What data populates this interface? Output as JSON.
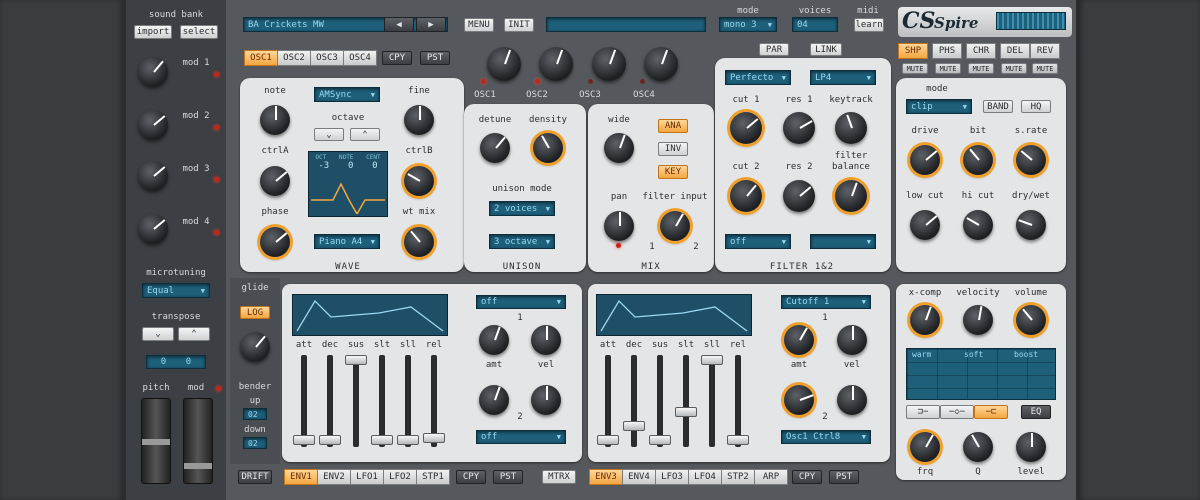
{
  "bank": {
    "title": "sound bank",
    "import": "import",
    "select": "select",
    "mods": [
      "mod 1",
      "mod 2",
      "mod 3",
      "mod 4"
    ],
    "microtuning_label": "microtuning",
    "microtuning_value": "Equal",
    "transpose_label": "transpose",
    "transpose_values": [
      "0",
      "0"
    ],
    "glide": "glide",
    "log": "LOG",
    "bender": "bender",
    "up": "up",
    "up_value": "02",
    "down": "down",
    "down_value": "02",
    "pitch": "pitch",
    "mod": "mod",
    "drift": "DRIFT"
  },
  "topbar": {
    "preset": "BA Crickets MW",
    "menu": "MENU",
    "init": "INIT",
    "mode_label": "mode",
    "mode_value": "mono 3",
    "voices_label": "voices",
    "voices_value": "04",
    "midi_label": "midi",
    "learn": "learn",
    "brand": "Spire"
  },
  "osc": {
    "tabs": [
      "OSC1",
      "OSC2",
      "OSC3",
      "OSC4"
    ],
    "cpy": "CPY",
    "pst": "PST",
    "note": "note",
    "fine": "fine",
    "type": "AMSync",
    "octave": "octave",
    "ctrlA": "ctrlA",
    "ctrlB": "ctrlB",
    "phase": "phase",
    "wtmix": "wt mix",
    "scope_labels": [
      "OCT",
      "NOTE",
      "CENT"
    ],
    "scope_values": [
      "-3",
      "0",
      "0"
    ],
    "wavetable": "Piano A4",
    "wave": "WAVE"
  },
  "mixer": {
    "osc_knobs": [
      "OSC1",
      "OSC2",
      "OSC3",
      "OSC4"
    ],
    "detune": "detune",
    "density": "density",
    "unison_mode": "unison mode",
    "voices": "2 voices",
    "octave": "3 octave",
    "unison": "UNISON",
    "wide": "wide",
    "ana": "ANA",
    "inv": "INV",
    "key": "KEY",
    "pan": "pan",
    "filter_input": "filter input",
    "fi_1": "1",
    "fi_2": "2",
    "mix": "MIX"
  },
  "filter": {
    "par": "PAR",
    "link": "LINK",
    "type1": "Perfecto",
    "type2": "LP4",
    "cut1": "cut 1",
    "res1": "res 1",
    "keytrack": "keytrack",
    "cut2": "cut 2",
    "res2": "res 2",
    "balance": "filter\nbalance",
    "sel1": "off",
    "sel2": "",
    "title": "FILTER 1&2"
  },
  "fx": {
    "tabs": [
      "SHP",
      "PHS",
      "CHR",
      "DEL",
      "REV"
    ],
    "mute": "MUTE",
    "mode": "mode",
    "clip": "clip",
    "band": "BAND",
    "hq": "HQ",
    "drive": "drive",
    "bit": "bit",
    "srate": "s.rate",
    "lowcut": "low cut",
    "hicut": "hi cut",
    "drywet": "dry/wet"
  },
  "env": {
    "labels": [
      "att",
      "dec",
      "sus",
      "slt",
      "sll",
      "rel"
    ],
    "dest1_left": "off",
    "dest2_left": "off",
    "n1": "1",
    "n2": "2",
    "amt": "amt",
    "vel": "vel",
    "dest1_right": "Cutoff 1",
    "dest2_right": "Osc1 Ctrl8",
    "tabs_left": [
      "ENV1",
      "ENV2",
      "LFO1",
      "LFO2",
      "STP1"
    ],
    "tabs_right": [
      "ENV3",
      "ENV4",
      "LFO3",
      "LFO4",
      "STP2",
      "ARP"
    ],
    "cpy": "CPY",
    "pst": "PST",
    "mtrx": "MTRX"
  },
  "eq": {
    "xcomp": "x-comp",
    "velocity": "velocity",
    "volume": "volume",
    "warm": "warm",
    "soft": "soft",
    "boost": "boost",
    "eq": "EQ",
    "frq": "frq",
    "q": "Q",
    "level": "level"
  },
  "colors": {
    "accent": "#f4a640",
    "lcd": "#1e5f7a",
    "panel": "#e4e5e6",
    "led": "#c0261a"
  }
}
